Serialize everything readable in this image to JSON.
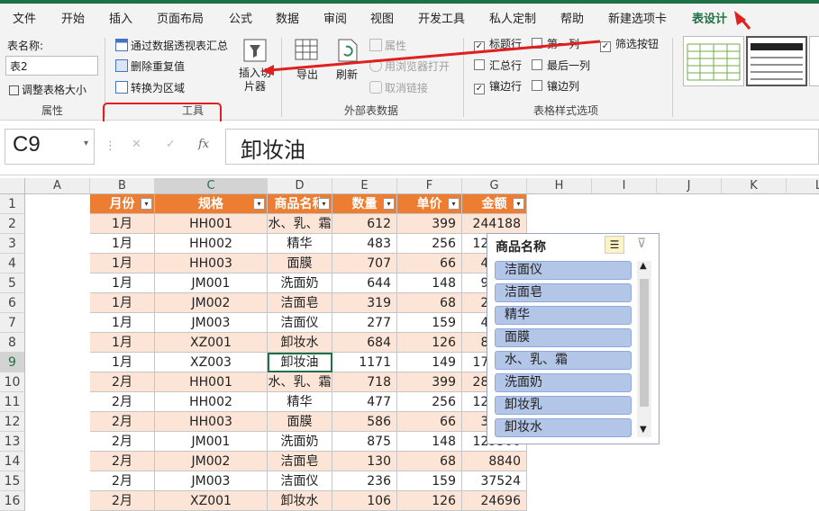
{
  "tabs": [
    "文件",
    "开始",
    "插入",
    "页面布局",
    "公式",
    "数据",
    "审阅",
    "视图",
    "开发工具",
    "私人定制",
    "帮助",
    "新建选项卡",
    "表设计"
  ],
  "ribbon": {
    "table_name_label": "表名称:",
    "table_name_value": "表2",
    "resize_table": "调整表格大小",
    "group_properties": "属性",
    "summarize_pivot": "通过数据透视表汇总",
    "remove_duplicates": "删除重复值",
    "convert_to_range": "转换为区域",
    "insert_slicer": "插入切片器",
    "group_tools": "工具",
    "export": "导出",
    "refresh": "刷新",
    "properties": "属性",
    "open_in_browser": "用浏览器打开",
    "unlink": "取消链接",
    "group_external": "外部表数据",
    "header_row": "标题行",
    "first_column": "第一列",
    "filter_button": "筛选按钮",
    "total_row": "汇总行",
    "last_column": "最后一列",
    "banded_rows": "镶边行",
    "banded_columns": "镶边列",
    "group_style_options": "表格样式选项"
  },
  "formula_bar": {
    "cell_ref": "C9",
    "cancel": "✕",
    "enter": "✓",
    "fx": "fx",
    "value": "卸妆油"
  },
  "columns": [
    "A",
    "B",
    "C",
    "D",
    "E",
    "F",
    "G",
    "H",
    "I",
    "J",
    "K",
    "L"
  ],
  "rows": [
    "1",
    "2",
    "3",
    "4",
    "5",
    "6",
    "7",
    "8",
    "9",
    "10",
    "11",
    "12",
    "13",
    "14",
    "15",
    "16"
  ],
  "table": {
    "headers": [
      "月份",
      "规格",
      "商品名称",
      "数量",
      "单价",
      "金额"
    ],
    "data": [
      [
        "1月",
        "HH001",
        "水、乳、霜",
        "612",
        "399",
        "244188"
      ],
      [
        "1月",
        "HH002",
        "精华",
        "483",
        "256",
        "123648"
      ],
      [
        "1月",
        "HH003",
        "面膜",
        "707",
        "66",
        "46662"
      ],
      [
        "1月",
        "JM001",
        "洗面奶",
        "644",
        "148",
        "95312"
      ],
      [
        "1月",
        "JM002",
        "洁面皂",
        "319",
        "68",
        "21692"
      ],
      [
        "1月",
        "JM003",
        "洁面仪",
        "277",
        "159",
        "44043"
      ],
      [
        "1月",
        "XZ001",
        "卸妆水",
        "684",
        "126",
        "86184"
      ],
      [
        "1月",
        "XZ003",
        "卸妆油",
        "1171",
        "149",
        "174479"
      ],
      [
        "2月",
        "HH001",
        "水、乳、霜",
        "718",
        "399",
        "286482"
      ],
      [
        "2月",
        "HH002",
        "精华",
        "477",
        "256",
        "122112"
      ],
      [
        "2月",
        "HH003",
        "面膜",
        "586",
        "66",
        "38676"
      ],
      [
        "2月",
        "JM001",
        "洗面奶",
        "875",
        "148",
        "129500"
      ],
      [
        "2月",
        "JM002",
        "洁面皂",
        "130",
        "68",
        "8840"
      ],
      [
        "2月",
        "JM003",
        "洁面仪",
        "236",
        "159",
        "37524"
      ],
      [
        "2月",
        "XZ001",
        "卸妆水",
        "106",
        "126",
        "24696"
      ]
    ]
  },
  "slicer": {
    "title": "商品名称",
    "items": [
      "洁面仪",
      "洁面皂",
      "精华",
      "面膜",
      "水、乳、霜",
      "洗面奶",
      "卸妆乳",
      "卸妆水"
    ]
  },
  "colors": {
    "accent": "#1e7145",
    "header_fill": "#ed7d31",
    "band_fill": "#fce4d6",
    "slicer_item": "#b4c6e7",
    "annotation": "#e02020"
  }
}
